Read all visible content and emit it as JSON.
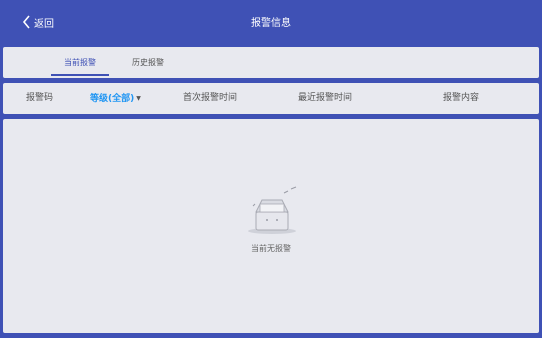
{
  "header": {
    "back_label": "返回",
    "title": "报警信息"
  },
  "tabs": [
    {
      "label": "当前报警",
      "active": true
    },
    {
      "label": "历史报警",
      "active": false
    }
  ],
  "columns": {
    "code": "报警码",
    "level_filter": "等级(全部)",
    "first_time": "首次报警时间",
    "last_time": "最近报警时间",
    "content": "报警内容"
  },
  "empty_state": {
    "icon": "empty-box-icon",
    "message": "当前无报警"
  },
  "colors": {
    "primary": "#3f51b5",
    "filter_blue": "#2196f3",
    "panel": "#e8e9ef"
  }
}
